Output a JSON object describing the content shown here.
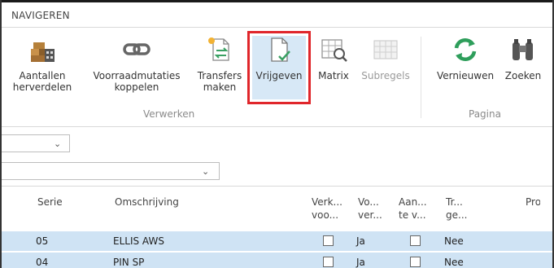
{
  "ribbon": {
    "tab_label": "NAVIGEREN",
    "buttons": [
      {
        "name": "Aantallen herverdelen",
        "line1": "Aantallen",
        "line2": "herverdelen",
        "icon": "warehouse-icon"
      },
      {
        "name": "Voorraadmutaties koppelen",
        "line1": "Voorraadmutaties",
        "line2": "koppelen",
        "icon": "link-icon"
      },
      {
        "name": "Transfers maken",
        "line1": "Transfers",
        "line2": "maken",
        "icon": "transfer-icon"
      },
      {
        "name": "Vrijgeven",
        "line1": "Vrijgeven",
        "line2": "",
        "icon": "document-check-icon"
      },
      {
        "name": "Matrix",
        "line1": "Matrix",
        "line2": "",
        "icon": "matrix-icon"
      },
      {
        "name": "Subregels",
        "line1": "Subregels",
        "line2": "",
        "icon": "grid-icon"
      },
      {
        "name": "Vernieuwen",
        "line1": "Vernieuwen",
        "line2": "",
        "icon": "refresh-icon"
      },
      {
        "name": "Zoeken",
        "line1": "Zoeken",
        "line2": "",
        "icon": "binoculars-icon"
      }
    ],
    "groups": {
      "verwerken": "Verwerken",
      "pagina": "Pagina"
    }
  },
  "grid": {
    "columns": [
      {
        "line1": "Serie",
        "line2": ""
      },
      {
        "line1": "Omschrijving",
        "line2": ""
      },
      {
        "line1": "Verk...",
        "line2": "voo..."
      },
      {
        "line1": "Vo...",
        "line2": "ver..."
      },
      {
        "line1": "Aan...",
        "line2": "te v..."
      },
      {
        "line1": "Tr...",
        "line2": "ge..."
      },
      {
        "line1": "Pro",
        "line2": ""
      }
    ],
    "rows": [
      {
        "serie": "05",
        "omschrijving": "ELLIS AWS",
        "vo": "Ja",
        "tr": "Nee"
      },
      {
        "serie": "04",
        "omschrijving": "PIN SP",
        "vo": "Ja",
        "tr": "Nee"
      }
    ]
  },
  "colors": {
    "accent_red": "#e0262b",
    "row_selected": "#cfe3f4",
    "refresh_green": "#2e9e5b"
  }
}
